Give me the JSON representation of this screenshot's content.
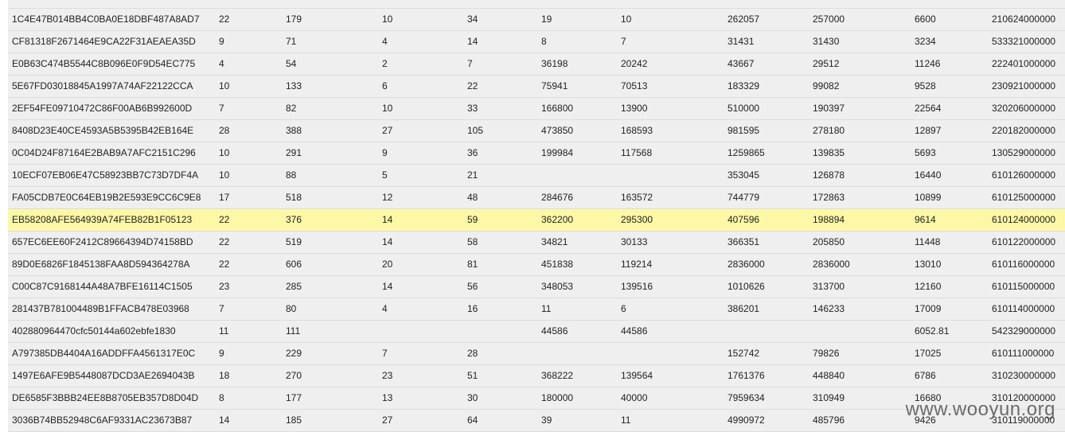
{
  "table": {
    "rows": [
      [
        "1C4E47B014BB4C0BA0E18DBF487A8AD7",
        "22",
        "179",
        "10",
        "34",
        "19",
        "10",
        "262057",
        "257000",
        "6600",
        "210624000000"
      ],
      [
        "CF81318F2671464E9CA22F31AEAEA35D",
        "9",
        "71",
        "4",
        "14",
        "8",
        "7",
        "31431",
        "31430",
        "3234",
        "533321000000"
      ],
      [
        "E0B63C474B5544C8B096E0F9D54EC775",
        "4",
        "54",
        "2",
        "7",
        "36198",
        "20242",
        "43667",
        "29512",
        "11246",
        "222401000000"
      ],
      [
        "5E67FD03018845A1997A74AF22122CCA",
        "10",
        "133",
        "6",
        "22",
        "75941",
        "70513",
        "183329",
        "99082",
        "9528",
        "230921000000"
      ],
      [
        "2EF54FE09710472C86F00AB6B992600D",
        "7",
        "82",
        "10",
        "33",
        "166800",
        "13900",
        "510000",
        "190397",
        "22564",
        "320206000000"
      ],
      [
        "8408D23E40CE4593A5B5395B42EB164E",
        "28",
        "388",
        "27",
        "105",
        "473850",
        "168593",
        "981595",
        "278180",
        "12897",
        "220182000000"
      ],
      [
        "0C04D24F87164E2BAB9A7AFC2151C296",
        "10",
        "291",
        "9",
        "36",
        "199984",
        "117568",
        "1259865",
        "139835",
        "5693",
        "130529000000"
      ],
      [
        "10ECF07EB06E47C58923BB7C73D7DF4A",
        "10",
        "88",
        "5",
        "21",
        "",
        "",
        "353045",
        "126878",
        "16440",
        "610126000000"
      ],
      [
        "FA05CDB7E0C64EB19B2E593E9CC6C9E8",
        "17",
        "518",
        "12",
        "48",
        "284676",
        "163572",
        "744779",
        "172863",
        "10899",
        "610125000000"
      ],
      [
        "EB58208AFE564939A74FEB82B1F05123",
        "22",
        "376",
        "14",
        "59",
        "362200",
        "295300",
        "407596",
        "198894",
        "9614",
        "610124000000"
      ],
      [
        "657EC6EE60F2412C89664394D74158BD",
        "22",
        "519",
        "14",
        "58",
        "34821",
        "30133",
        "366351",
        "205850",
        "11448",
        "610122000000"
      ],
      [
        "89D0E6826F1845138FAA8D594364278A",
        "22",
        "606",
        "20",
        "81",
        "451838",
        "119214",
        "2836000",
        "2836000",
        "13010",
        "610116000000"
      ],
      [
        "C00C87C9168144A48A7BFE16114C1505",
        "23",
        "285",
        "14",
        "56",
        "348053",
        "139516",
        "1010626",
        "313700",
        "12160",
        "610115000000"
      ],
      [
        "281437B781004489B1FFACB478E03968",
        "7",
        "80",
        "4",
        "16",
        "11",
        "6",
        "386201",
        "146233",
        "17009",
        "610114000000"
      ],
      [
        "402880964470cfc50144a602ebfe1830",
        "11",
        "111",
        "",
        "",
        "44586",
        "44586",
        "",
        "",
        "6052.81",
        "542329000000"
      ],
      [
        "A797385DB4404A16ADDFFA4561317E0C",
        "9",
        "229",
        "7",
        "28",
        "",
        "",
        "152742",
        "79826",
        "17025",
        "610111000000"
      ],
      [
        "1497E6AFE9B5448087DCD3AE2694043B",
        "18",
        "270",
        "23",
        "51",
        "368222",
        "139564",
        "1761376",
        "448840",
        "6786",
        "310230000000"
      ],
      [
        "DE6585F3BBB24EE8B8705EB357D8D04D",
        "8",
        "177",
        "13",
        "30",
        "180000",
        "40000",
        "7959634",
        "310949",
        "16680",
        "310120000000"
      ],
      [
        "3036B74BB52948C6AF9331AC23673B87",
        "14",
        "185",
        "27",
        "64",
        "39",
        "11",
        "4990972",
        "485796",
        "9426",
        "310119000000"
      ]
    ],
    "highlighted_row": 9,
    "highlight_color": "#fdf8a6"
  },
  "watermark": "www.wooyun.org"
}
